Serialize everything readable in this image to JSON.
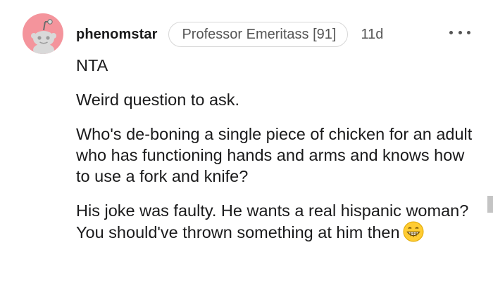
{
  "comment": {
    "username": "phenomstar",
    "flair": "Professor Emeritass [91]",
    "age": "11d",
    "avatar_icon": "snoo-avatar-icon",
    "more_icon": "more-options-icon",
    "paragraphs": [
      "NTA",
      "Weird question to ask.",
      "Who's de-boning a single piece of chicken for an adult who has functioning hands and arms and knows how to use a fork and knife?",
      "His joke was faulty. He wants a real hispanic woman? You should've thrown something at him then"
    ],
    "trailing_emoji": "grinning-face-icon"
  },
  "colors": {
    "avatar_bg": "#f4949c",
    "text": "#1a1a1b",
    "meta": "#555555"
  }
}
